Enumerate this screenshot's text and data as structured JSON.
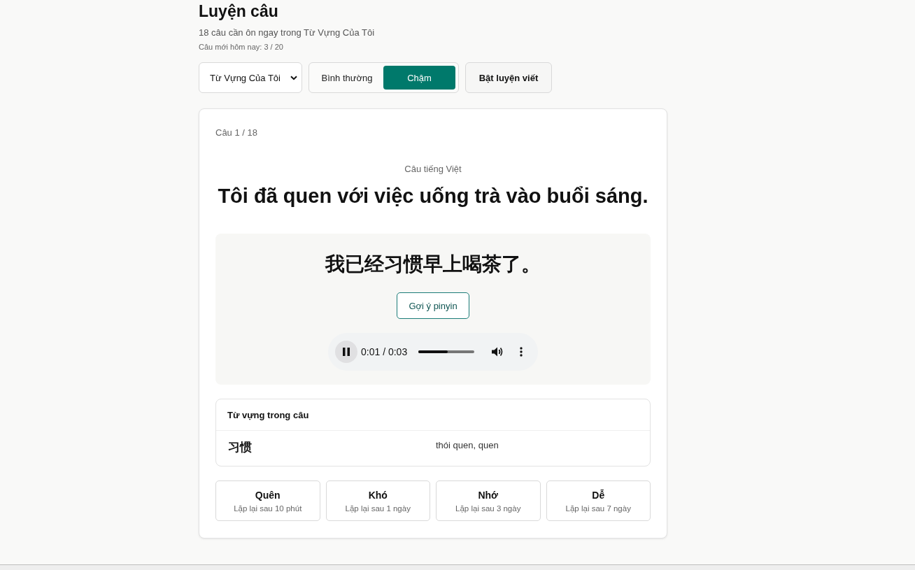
{
  "header": {
    "title": "Luyện câu",
    "subtitle": "18 câu cần ôn ngay trong Từ Vựng Của Tôi",
    "daily": "Câu mới hôm nay: 3 / 20"
  },
  "controls": {
    "deck_select": {
      "value": "Từ Vựng Của Tôi"
    },
    "speeds": [
      {
        "label": "Bình thường",
        "selected": false
      },
      {
        "label": "Chậm",
        "selected": true
      }
    ],
    "writing_button": "Bật luyện viết"
  },
  "card": {
    "counter": "Câu 1 / 18",
    "prompt_label": "Câu tiếng Việt",
    "prompt": "Tôi đã quen với việc uống trà vào buổi sáng.",
    "answer": {
      "sentence": "我已经习惯早上喝茶了。",
      "hint_button": "Gợi ý pinyin",
      "audio": {
        "playing": true,
        "time": "0:01 / 0:03",
        "level": 0.52
      }
    },
    "vocab": {
      "title": "Từ vựng trong câu",
      "items": [
        {
          "word": "习惯",
          "meaning": "thói quen, quen"
        }
      ]
    },
    "ratings": [
      {
        "label": "Quên",
        "note": "Lặp lại sau 10 phút"
      },
      {
        "label": "Khó",
        "note": "Lặp lại sau 1 ngày"
      },
      {
        "label": "Nhớ",
        "note": "Lặp lại sau 3 ngày"
      },
      {
        "label": "Dễ",
        "note": "Lặp lại sau 7 ngày"
      }
    ]
  }
}
